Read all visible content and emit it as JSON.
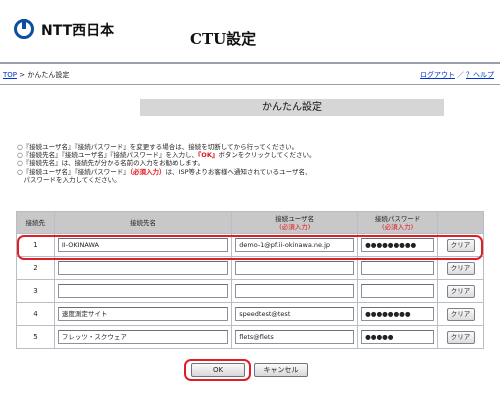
{
  "header": {
    "logo_text": "NTT西日本",
    "title": "CTU設定"
  },
  "breadcrumb": {
    "top": "TOP",
    "separator": ">",
    "current": "かんたん設定"
  },
  "top_links": {
    "logout": "ログアウト",
    "separator": "／",
    "help": "？ヘルプ"
  },
  "section_title": "かんたん設定",
  "notes": [
    {
      "prefix": "○『接続ユーザ名』『接続パスワード』を変更する場合は、接続を切断してから行ってください。"
    },
    {
      "prefix": "○『接続先名』『接続ユーザ名』『接続パスワード』を入力し、",
      "red": "『OK』",
      "suffix": "ボタンをクリックしてください。"
    },
    {
      "prefix": "○『接続先名』は、接続先が分かる名前の入力をお勧めします。"
    },
    {
      "prefix": "○『接続ユーザ名』『接続パスワード』",
      "red": "（必須入力）",
      "suffix": "は、ISP等よりお客様へ通知されているユーザ名、"
    },
    {
      "prefix": "　パスワードを入力してください。"
    }
  ],
  "table": {
    "headers": {
      "num": "接続先",
      "name": "接続先名",
      "user": "接続ユーザ名",
      "user_required": "(必須入力)",
      "pass": "接続パスワード",
      "pass_required": "(必須入力)"
    },
    "rows": [
      {
        "num": "1",
        "name": "II-OKINAWA",
        "user": "demo-1@pf.ii-okinawa.ne.jp",
        "pass": "●●●●●●●●●",
        "clear": "クリア"
      },
      {
        "num": "2",
        "name": "",
        "user": "",
        "pass": "",
        "clear": "クリア"
      },
      {
        "num": "3",
        "name": "",
        "user": "",
        "pass": "",
        "clear": "クリア"
      },
      {
        "num": "4",
        "name": "速度測定サイト",
        "user": "speedtest@test",
        "pass": "●●●●●●●●",
        "clear": "クリア"
      },
      {
        "num": "5",
        "name": "フレッツ・スクウェア",
        "user": "flets@flets",
        "pass": "●●●●●",
        "clear": "クリア"
      }
    ]
  },
  "buttons": {
    "ok": "OK",
    "cancel": "キャンセル"
  },
  "colors": {
    "brand": "#0b4ea2",
    "highlight": "#e11d26",
    "link": "#0033cc"
  }
}
